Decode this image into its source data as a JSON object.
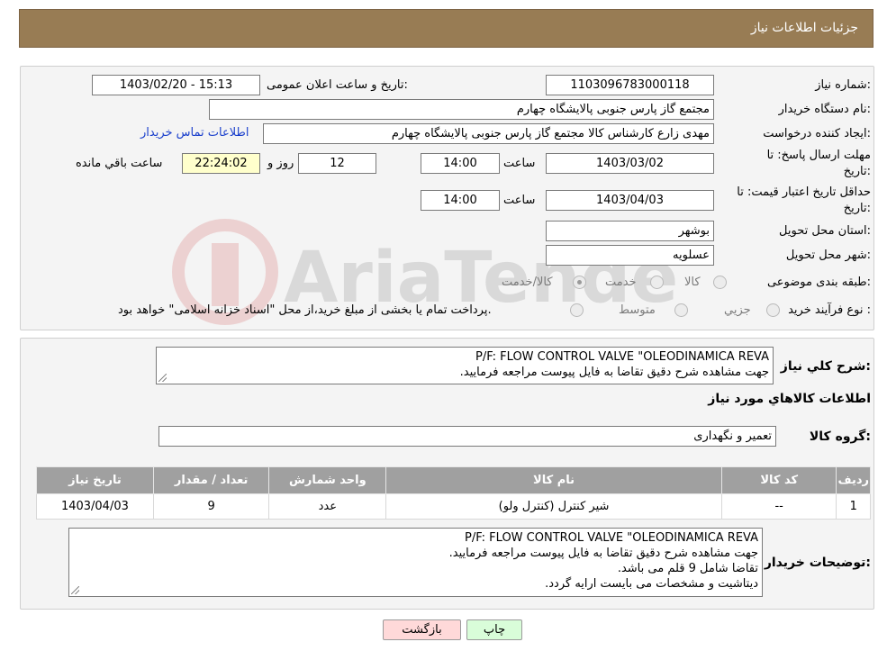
{
  "header": {
    "title": "جزئیات اطلاعات نیاز"
  },
  "form": {
    "need_number_label": "شماره نیاز:",
    "need_number": "1103096783000118",
    "announce_label": "تاریخ و ساعت اعلان عمومی:",
    "announce_value": "1403/02/20 - 15:13",
    "buyer_label": "نام دستگاه خریدار:",
    "buyer_value": "مجتمع گاز پارس جنوبی  پالایشگاه چهارم",
    "creator_label": "ایجاد کننده درخواست:",
    "creator_value": "مهدی زارع کارشناس کالا مجتمع گاز پارس جنوبی  پالایشگاه چهارم",
    "contact_link": "اطلاعات تماس خریدار",
    "deadline_label_1": "مهلت ارسال پاسخ: تا",
    "deadline_label_2": "تاریخ:",
    "deadline_date": "1403/03/02",
    "time_label": "ساعت",
    "deadline_time": "14:00",
    "days_value": "12",
    "days_label": "روز و",
    "remaining_value": "22:24:02",
    "remaining_label": "ساعت باقي مانده",
    "validity_label_1": "حداقل تاریخ اعتبار قیمت: تا",
    "validity_label_2": "تاریخ:",
    "validity_date": "1403/04/03",
    "validity_time": "14:00",
    "province_label": "استان محل تحویل:",
    "province_value": "بوشهر",
    "city_label": "شهر محل تحویل:",
    "city_value": "عسلویه",
    "category_label": "طبقه بندی موضوعی:",
    "category_options": [
      "کالا",
      "خدمت",
      "کالا/خدمت"
    ],
    "process_label": "نوع فرآیند خرید :",
    "process_options": [
      "جزیي",
      "متوسط"
    ],
    "process_note": "پرداخت تمام یا بخشی از مبلغ خرید،از محل \"اسناد خزانه اسلامی\" خواهد بود."
  },
  "summary": {
    "label": "شرح کلي نياز:",
    "line1": "P/F: FLOW CONTROL VALVE \"OLEODINAMICA REVA",
    "line2": "جهت مشاهده شرح دقیق تقاضا به فایل پیوست مراجعه فرمایید."
  },
  "goods": {
    "section_title": "اطلاعات کالاهاي مورد نياز",
    "group_label": "گروه کالا:",
    "group_value": "تعمیر و نگهداری",
    "columns": [
      "رديف",
      "کد کالا",
      "نام کالا",
      "واحد شمارش",
      "تعداد / مقدار",
      "تاريخ نياز"
    ],
    "rows": [
      {
        "row": "1",
        "code": "--",
        "name": "شیر کنترل (کنترل ولو)",
        "unit": "عدد",
        "qty": "9",
        "date": "1403/04/03"
      }
    ]
  },
  "buyer_notes": {
    "label": "توضیحات خریدار:",
    "line1": "P/F: FLOW CONTROL VALVE \"OLEODINAMICA REVA",
    "line2": "جهت مشاهده شرح دقیق تقاضا به فایل پیوست مراجعه فرمایید.",
    "line3": "تقاضا شامل 9 قلم می باشد.",
    "line4": "دیتاشیت و مشخصات می بایست ارایه گردد."
  },
  "buttons": {
    "print": "چاپ",
    "back": "بازگشت"
  },
  "watermark_text": "AriaTender.neT",
  "colors": {
    "header": "#987c54",
    "table_header": "#a0a0a0",
    "back_button": "#ffd9d9",
    "print_button": "#d9fdd9",
    "link": "#1a3fcc"
  }
}
